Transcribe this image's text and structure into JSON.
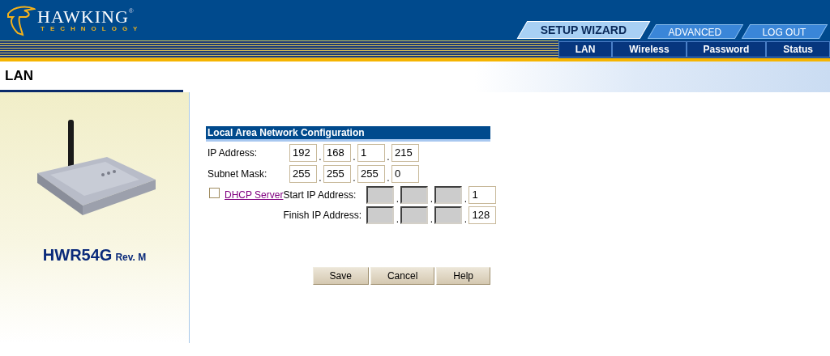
{
  "logo": {
    "name": "HAWKING",
    "tagline": "TECHNOLOGY",
    "mark": "®"
  },
  "tabs": [
    {
      "label": "SETUP WIZARD",
      "selected": true
    },
    {
      "label": "ADVANCED",
      "selected": false
    },
    {
      "label": "LOG OUT",
      "selected": false
    }
  ],
  "subnav": [
    "LAN",
    "Wireless",
    "Password",
    "Status"
  ],
  "page_title": "LAN",
  "product": {
    "model": "HWR54G",
    "revision": "Rev. M"
  },
  "form": {
    "title": "Local Area Network Configuration",
    "separator": ".",
    "rows": [
      {
        "label": "IP Address:",
        "octets": [
          {
            "value": "192",
            "disabled": false
          },
          {
            "value": "168",
            "disabled": false
          },
          {
            "value": "1",
            "disabled": false
          },
          {
            "value": "215",
            "disabled": false
          }
        ]
      },
      {
        "label": "Subnet Mask:",
        "octets": [
          {
            "value": "255",
            "disabled": false
          },
          {
            "value": "255",
            "disabled": false
          },
          {
            "value": "255",
            "disabled": false
          },
          {
            "value": "0",
            "disabled": false
          }
        ]
      }
    ],
    "dhcp": {
      "label": "DHCP Server",
      "checked": false,
      "rows": [
        {
          "label": "Start IP Address:",
          "octets": [
            {
              "disabled": true
            },
            {
              "disabled": true
            },
            {
              "disabled": true
            },
            {
              "value": "1",
              "disabled": false
            }
          ]
        },
        {
          "label": "Finish IP Address:",
          "octets": [
            {
              "disabled": true
            },
            {
              "disabled": true
            },
            {
              "disabled": true
            },
            {
              "value": "128",
              "disabled": false
            }
          ]
        }
      ]
    },
    "buttons": [
      "Save",
      "Cancel",
      "Help"
    ]
  }
}
